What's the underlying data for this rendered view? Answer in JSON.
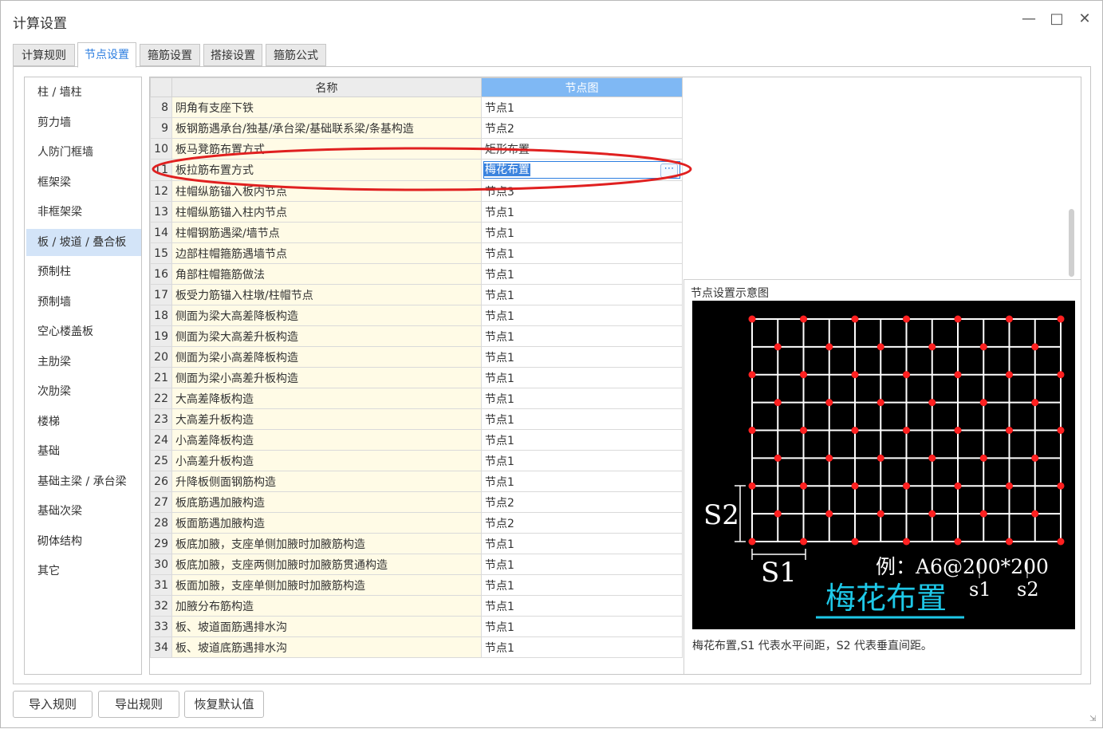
{
  "window": {
    "title": "计算设置",
    "minimize_icon": "minimize-icon",
    "maximize_icon": "maximize-icon",
    "close_icon": "close-icon"
  },
  "tabs": [
    {
      "label": "计算规则",
      "active": false
    },
    {
      "label": "节点设置",
      "active": true
    },
    {
      "label": "箍筋设置",
      "active": false
    },
    {
      "label": "搭接设置",
      "active": false
    },
    {
      "label": "箍筋公式",
      "active": false
    }
  ],
  "sidebar": {
    "items": [
      {
        "label": "柱 / 墙柱"
      },
      {
        "label": "剪力墙"
      },
      {
        "label": "人防门框墙"
      },
      {
        "label": "框架梁"
      },
      {
        "label": "非框架梁"
      },
      {
        "label": "板 / 坡道 / 叠合板",
        "active": true
      },
      {
        "label": "预制柱"
      },
      {
        "label": "预制墙"
      },
      {
        "label": "空心楼盖板"
      },
      {
        "label": "主肋梁"
      },
      {
        "label": "次肋梁"
      },
      {
        "label": "楼梯"
      },
      {
        "label": "基础"
      },
      {
        "label": "基础主梁 / 承台梁"
      },
      {
        "label": "基础次梁"
      },
      {
        "label": "砌体结构"
      },
      {
        "label": "其它"
      }
    ]
  },
  "grid": {
    "columns": {
      "name": "名称",
      "value": "节点图"
    },
    "rows": [
      {
        "num": "8",
        "name": "阴角有支座下铁",
        "value": "节点1"
      },
      {
        "num": "9",
        "name": "板钢筋遇承台/独基/承台梁/基础联系梁/条基构造",
        "value": "节点2"
      },
      {
        "num": "10",
        "name": "板马凳筋布置方式",
        "value": "矩形布置"
      },
      {
        "num": "11",
        "name": "板拉筋布置方式",
        "value": "梅花布置",
        "active": true
      },
      {
        "num": "12",
        "name": "柱帽纵筋锚入板内节点",
        "value": "节点3"
      },
      {
        "num": "13",
        "name": "柱帽纵筋锚入柱内节点",
        "value": "节点1"
      },
      {
        "num": "14",
        "name": "柱帽钢筋遇梁/墙节点",
        "value": "节点1"
      },
      {
        "num": "15",
        "name": "边部柱帽箍筋遇墙节点",
        "value": "节点1"
      },
      {
        "num": "16",
        "name": "角部柱帽箍筋做法",
        "value": "节点1"
      },
      {
        "num": "17",
        "name": "板受力筋锚入柱墩/柱帽节点",
        "value": "节点1"
      },
      {
        "num": "18",
        "name": "侧面为梁大高差降板构造",
        "value": "节点1"
      },
      {
        "num": "19",
        "name": "侧面为梁大高差升板构造",
        "value": "节点1"
      },
      {
        "num": "20",
        "name": "侧面为梁小高差降板构造",
        "value": "节点1"
      },
      {
        "num": "21",
        "name": "侧面为梁小高差升板构造",
        "value": "节点1"
      },
      {
        "num": "22",
        "name": "大高差降板构造",
        "value": "节点1"
      },
      {
        "num": "23",
        "name": "大高差升板构造",
        "value": "节点1"
      },
      {
        "num": "24",
        "name": "小高差降板构造",
        "value": "节点1"
      },
      {
        "num": "25",
        "name": "小高差升板构造",
        "value": "节点1"
      },
      {
        "num": "26",
        "name": "升降板侧面钢筋构造",
        "value": "节点1"
      },
      {
        "num": "27",
        "name": "板底筋遇加腋构造",
        "value": "节点2"
      },
      {
        "num": "28",
        "name": "板面筋遇加腋构造",
        "value": "节点2"
      },
      {
        "num": "29",
        "name": "板底加腋，支座单侧加腋时加腋筋构造",
        "value": "节点1"
      },
      {
        "num": "30",
        "name": "板底加腋，支座两侧加腋时加腋筋贯通构造",
        "value": "节点1"
      },
      {
        "num": "31",
        "name": "板面加腋，支座单侧加腋时加腋筋构造",
        "value": "节点1"
      },
      {
        "num": "32",
        "name": "加腋分布筋构造",
        "value": "节点1"
      },
      {
        "num": "33",
        "name": "板、坡道面筋遇排水沟",
        "value": "节点1"
      },
      {
        "num": "34",
        "name": "板、坡道底筋遇排水沟",
        "value": "节点1"
      }
    ],
    "edit_button_icon": "ellipsis-icon"
  },
  "preview": {
    "title": "节点设置示意图",
    "diagram": {
      "s2_label": "S2",
      "s1_label": "S1",
      "example_label": "例：A6@200*200",
      "s1_small": "s1",
      "s2_small": "s2",
      "layout_name": "梅花布置",
      "colors": {
        "background": "#000000",
        "grid": "#ffffff",
        "dot": "#ff2020",
        "title": "#1ec8e8"
      }
    },
    "caption": "梅花布置,S1 代表水平间距，S2 代表垂直间距。"
  },
  "buttons": {
    "import": "导入规则",
    "export": "导出规则",
    "restore": "恢复默认值"
  },
  "colors": {
    "accent": "#2b7de0",
    "highlight_ellipse": "#e02020",
    "name_cell_bg": "#fffbe6"
  }
}
